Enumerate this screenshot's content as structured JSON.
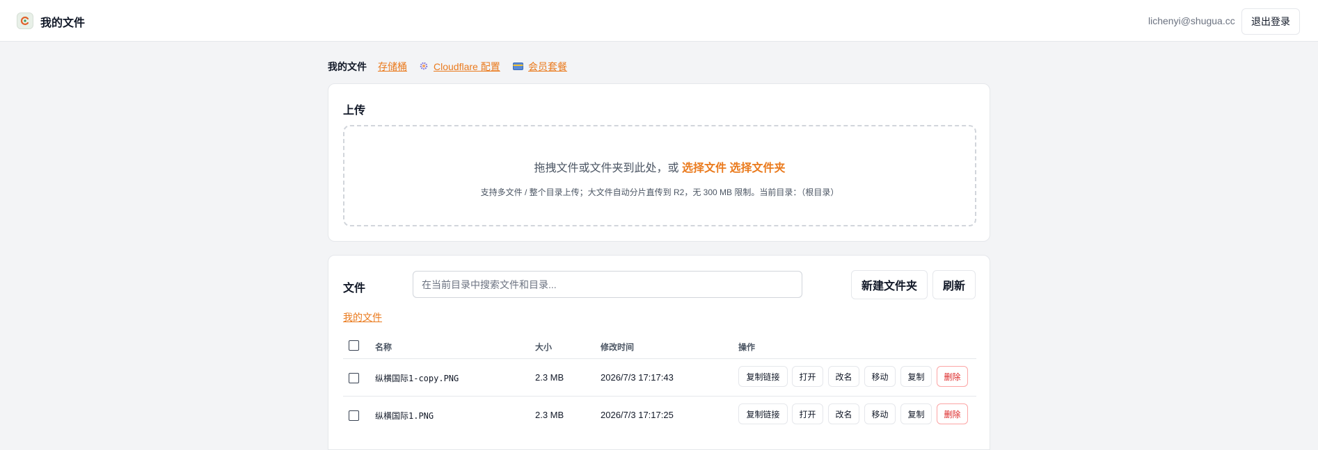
{
  "header": {
    "title": "我的文件",
    "logo_icon": "app-logo-icon",
    "user_email": "lichenyi@shugua.cc",
    "logout_label": "退出登录"
  },
  "nav": {
    "current": "我的文件",
    "links": [
      {
        "label": "存储桶",
        "icon": ""
      },
      {
        "label": "Cloudflare 配置",
        "icon": "gear-icon"
      },
      {
        "label": "会员套餐",
        "icon": "card-icon"
      }
    ]
  },
  "upload": {
    "title": "上传",
    "drop_text": "拖拽文件或文件夹到此处，或",
    "select_file": "选择文件",
    "select_folder": "选择文件夹",
    "hint": "支持多文件 / 整个目录上传；大文件自动分片直传到 R2，无 300 MB 限制。当前目录：（根目录）"
  },
  "files": {
    "title": "文件",
    "search_placeholder": "在当前目录中搜索文件和目录...",
    "new_folder_label": "新建文件夹",
    "refresh_label": "刷新",
    "breadcrumb": "我的文件",
    "columns": [
      "名称",
      "大小",
      "修改时间",
      "操作"
    ],
    "rows": [
      {
        "name": "纵横国际1-copy.PNG",
        "size": "2.3 MB",
        "modified": "2026/7/3 17:17:43"
      },
      {
        "name": "纵横国际1.PNG",
        "size": "2.3 MB",
        "modified": "2026/7/3 17:17:25"
      }
    ],
    "actions": [
      "复制链接",
      "打开",
      "改名",
      "移动",
      "复制",
      "删除"
    ]
  },
  "colors": {
    "accent": "#ea7a1d",
    "danger": "#dc2626",
    "background": "#f3f4f6"
  }
}
